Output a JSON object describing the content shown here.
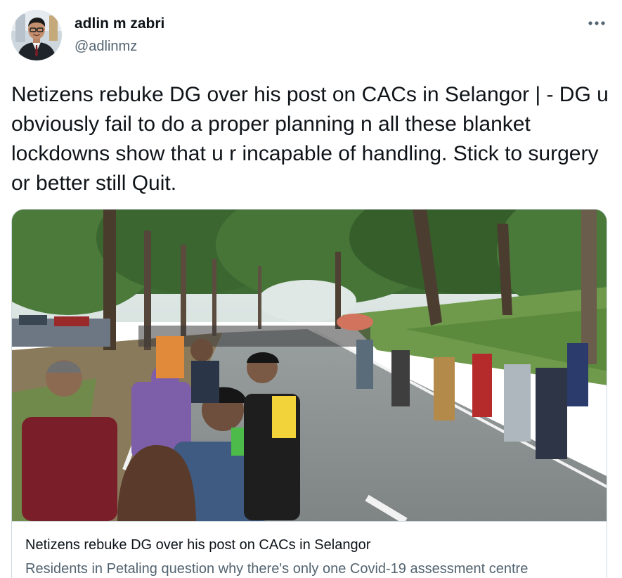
{
  "author": {
    "display_name": "adlin m zabri",
    "handle": "@adlinmz",
    "avatar_icon": "profile-photo"
  },
  "tweet": {
    "text": "Netizens rebuke DG over his post on CACs in Selangor | - DG u obviously fail to do a proper planning n all these blanket lockdowns show that u r incapable of handling. Stick to surgery or better still Quit."
  },
  "menu": {
    "icon": "more-options-icon"
  },
  "card": {
    "title": "Netizens rebuke DG over his post on CACs in Selangor",
    "description": "Residents in Petaling question why there's only one Covid-19 assessment centre"
  },
  "colors": {
    "primary_text": "#0f1419",
    "secondary_text": "#536471",
    "border": "#cfd9de"
  }
}
